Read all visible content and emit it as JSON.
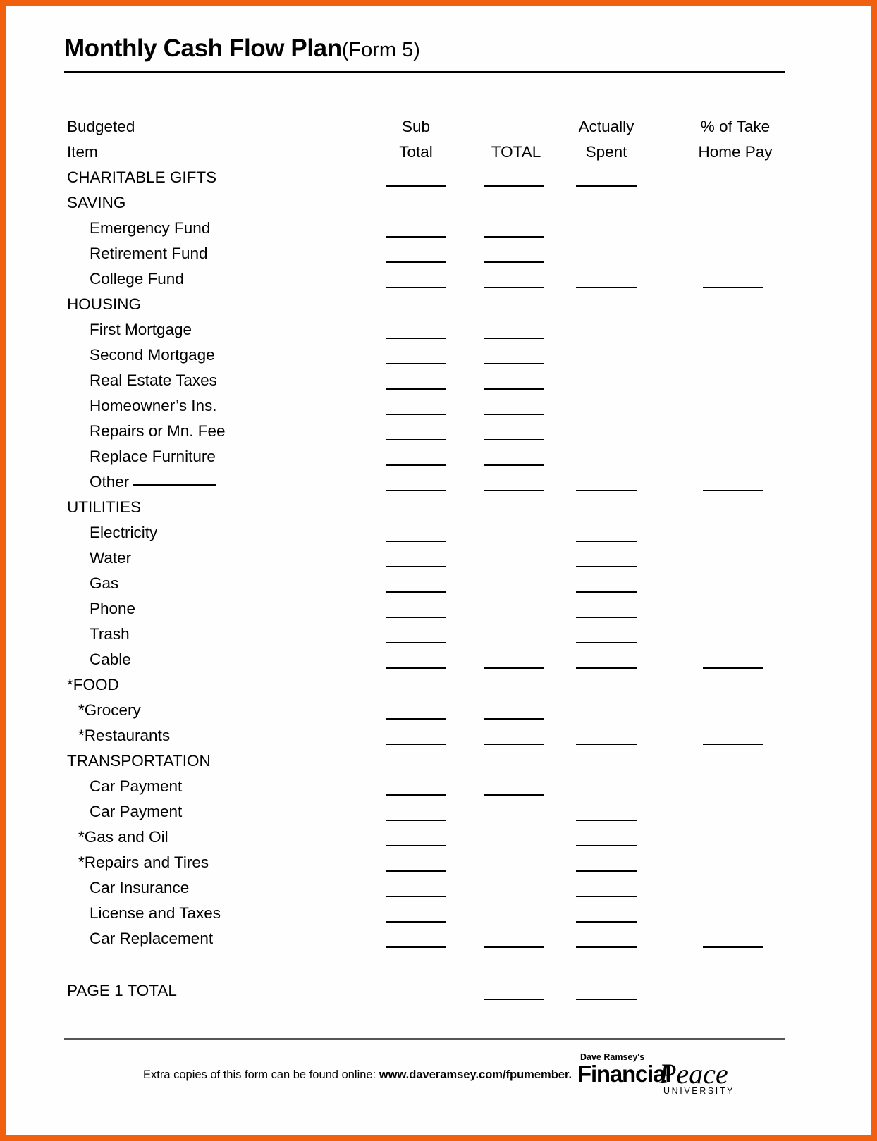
{
  "document": {
    "title_main": "Monthly Cash Flow Plan",
    "title_sub": "(Form 5)",
    "page_total_label": "PAGE 1 TOTAL"
  },
  "columns": {
    "item_line1": "Budgeted",
    "item_line2": "Item",
    "subtotal_line1": "Sub",
    "subtotal_line2": "Total",
    "total_line1": "",
    "total_line2": "TOTAL",
    "spent_line1": "Actually",
    "spent_line2": "Spent",
    "percent_line1": "% of Take",
    "percent_line2": "Home Pay"
  },
  "rows": [
    {
      "label": "CHARITABLE GIFTS",
      "kind": "section",
      "blanks": [
        true,
        true,
        true,
        false
      ]
    },
    {
      "label": "SAVING",
      "kind": "section",
      "blanks": [
        false,
        false,
        false,
        false
      ]
    },
    {
      "label": "Emergency Fund",
      "kind": "sub",
      "blanks": [
        true,
        true,
        false,
        false
      ]
    },
    {
      "label": "Retirement Fund",
      "kind": "sub",
      "blanks": [
        true,
        true,
        false,
        false
      ]
    },
    {
      "label": "College Fund",
      "kind": "sub",
      "blanks": [
        true,
        true,
        true,
        true
      ]
    },
    {
      "label": "HOUSING",
      "kind": "section",
      "blanks": [
        false,
        false,
        false,
        false
      ]
    },
    {
      "label": "First Mortgage",
      "kind": "sub",
      "blanks": [
        true,
        true,
        false,
        false
      ]
    },
    {
      "label": "Second Mortgage",
      "kind": "sub",
      "blanks": [
        true,
        true,
        false,
        false
      ]
    },
    {
      "label": "Real Estate Taxes",
      "kind": "sub",
      "blanks": [
        true,
        true,
        false,
        false
      ]
    },
    {
      "label": "Homeowner’s Ins.",
      "kind": "sub",
      "blanks": [
        true,
        true,
        false,
        false
      ]
    },
    {
      "label": "Repairs or Mn. Fee",
      "kind": "sub",
      "blanks": [
        true,
        true,
        false,
        false
      ]
    },
    {
      "label": "Replace Furniture",
      "kind": "sub",
      "blanks": [
        true,
        true,
        false,
        false
      ]
    },
    {
      "label": "Other",
      "kind": "sub",
      "inline_blank": true,
      "blanks": [
        true,
        true,
        true,
        true
      ]
    },
    {
      "label": "UTILITIES",
      "kind": "section",
      "blanks": [
        false,
        false,
        false,
        false
      ]
    },
    {
      "label": "Electricity",
      "kind": "sub",
      "blanks": [
        true,
        false,
        true,
        false
      ]
    },
    {
      "label": "Water",
      "kind": "sub",
      "blanks": [
        true,
        false,
        true,
        false
      ]
    },
    {
      "label": "Gas",
      "kind": "sub",
      "blanks": [
        true,
        false,
        true,
        false
      ]
    },
    {
      "label": "Phone",
      "kind": "sub",
      "blanks": [
        true,
        false,
        true,
        false
      ]
    },
    {
      "label": "Trash",
      "kind": "sub",
      "blanks": [
        true,
        false,
        true,
        false
      ]
    },
    {
      "label": "Cable",
      "kind": "sub",
      "blanks": [
        true,
        true,
        true,
        true
      ]
    },
    {
      "label": "*FOOD",
      "kind": "section",
      "blanks": [
        false,
        false,
        false,
        false
      ]
    },
    {
      "label": "*Grocery",
      "kind": "star",
      "blanks": [
        true,
        true,
        false,
        false
      ]
    },
    {
      "label": "*Restaurants",
      "kind": "star",
      "blanks": [
        true,
        true,
        true,
        true
      ]
    },
    {
      "label": "TRANSPORTATION",
      "kind": "section",
      "blanks": [
        false,
        false,
        false,
        false
      ]
    },
    {
      "label": "Car Payment",
      "kind": "sub",
      "blanks": [
        true,
        true,
        false,
        false
      ]
    },
    {
      "label": "Car Payment",
      "kind": "sub",
      "blanks": [
        true,
        false,
        true,
        false
      ]
    },
    {
      "label": "*Gas and Oil",
      "kind": "star",
      "blanks": [
        true,
        false,
        true,
        false
      ]
    },
    {
      "label": "*Repairs and Tires",
      "kind": "star",
      "blanks": [
        true,
        false,
        true,
        false
      ]
    },
    {
      "label": "Car Insurance",
      "kind": "sub",
      "blanks": [
        true,
        false,
        true,
        false
      ]
    },
    {
      "label": "License and Taxes",
      "kind": "sub",
      "blanks": [
        true,
        false,
        true,
        false
      ]
    },
    {
      "label": "Car Replacement",
      "kind": "sub",
      "blanks": [
        true,
        true,
        true,
        true
      ]
    }
  ],
  "page_total_blanks": [
    false,
    true,
    true,
    false
  ],
  "footer": {
    "text_prefix": "Extra copies of this form can be found online: ",
    "url": "www.daveramsey.com/fpumember.",
    "logo_top": "Dave Ramsey's",
    "logo_financial": "Financial",
    "logo_peace": "Peace",
    "logo_university": "UNIVERSITY"
  },
  "colors": {
    "border_accent": "#f0600e",
    "rule": "#000000",
    "page_bg": "#fefefe"
  }
}
